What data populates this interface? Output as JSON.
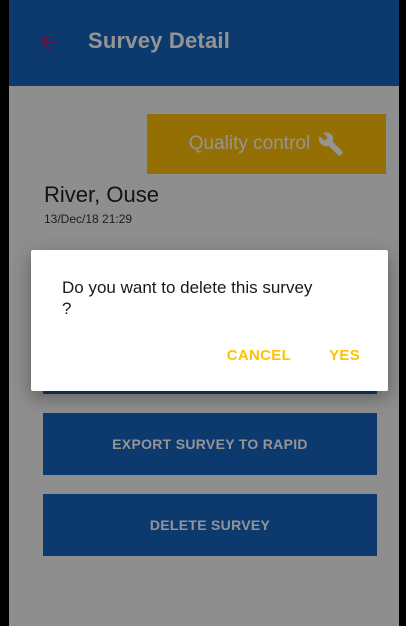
{
  "app_bar": {
    "title": "Survey Detail",
    "back_icon": "arrow-left-icon"
  },
  "colors": {
    "primary": "#1565c0",
    "accent": "#ffc107",
    "back_arrow": "#c2185b"
  },
  "quality_control": {
    "label": "Quality control",
    "icon": "wrench-icon"
  },
  "survey": {
    "river": "River, Ouse",
    "datetime": "13/Dec/18 21:29"
  },
  "actions": {
    "export_label": "EXPORT SURVEY TO RAPID",
    "delete_label": "DELETE SURVEY"
  },
  "dialog": {
    "message": "Do you want to delete this survey ?",
    "cancel_label": "CANCEL",
    "confirm_label": "YES"
  }
}
